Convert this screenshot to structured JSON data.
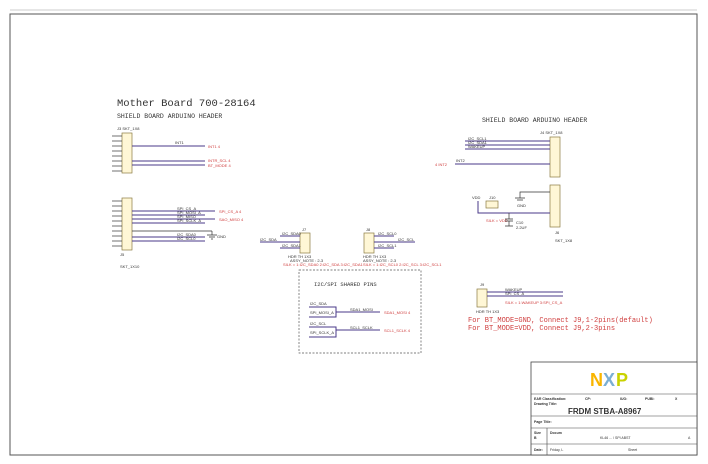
{
  "left": {
    "title": "Mother Board 700-28164",
    "subtitle": "SHIELD BOARD ARDUINO HEADER",
    "j_top": "J3  SKT_1X8",
    "top_nets": [
      "INT1",
      "INT1 4",
      "INTR_SCL 4",
      "BT_MODE 4"
    ],
    "j_bottom": "SKT_1X10",
    "j_bottom_ref": "J5",
    "spi_nets": [
      "SPI_CS_A",
      "SPI_MOSI_A",
      "SPI_MISO",
      "SPI_SCLK_A"
    ],
    "spi_out": [
      "SPI_CS_A 4",
      "SAO_MISO 4"
    ],
    "i2c_nets": [
      "I2C_SDA0",
      "I2C_SCL0"
    ],
    "gnd": "GND"
  },
  "j7": {
    "ref": "J7",
    "nets": [
      "I2C_SDA",
      "I2C_SDA0",
      "I2C_SDA1"
    ],
    "part": "HDR TH 1X3",
    "assy": "ASSY_NOTE : 2-3",
    "silk": "SILK = 1:I2C_SDA0 2:I2C_SDA 3:I2C_SDA1"
  },
  "j8": {
    "ref": "J8",
    "nets": [
      "I2C_SCL0",
      "I2C_SCL",
      "I2C_SCL1"
    ],
    "part": "HDR TH 1X3",
    "assy": "ASSY_NOTE : 2-3",
    "silk": "SILK = 1:I2C_SCL0 2:I2C_SCL 3:I2C_SCL1"
  },
  "shared": {
    "title": "I2C/SPI SHARED PINS",
    "in1": [
      "I2C_SDA",
      "SPI_MOSI_A"
    ],
    "net1": "SDA1_MOSI",
    "out1": "SDA1_MOSI 4",
    "in2": [
      "I2C_SCL",
      "SPI_SCLK_A"
    ],
    "net2": "SCL1_SCLK",
    "out2": "SCL1_SCLK 4"
  },
  "right": {
    "subtitle": "SHIELD BOARD ARDUINO HEADER",
    "j_top": "J4  SKT_1X8",
    "nets": [
      "I2C_SCL1",
      "I2C_SDA1",
      "WAKEUP",
      "INT2"
    ],
    "int_in": "4 INT2",
    "vdd": "VDD",
    "j10": "J10",
    "silk": "SILK = VDD",
    "cap": "C10",
    "cap_val": "2.2UF",
    "gnd": "GND",
    "j_bottom": "J6",
    "j_bottom_part": "SKT_1X8"
  },
  "j9": {
    "ref": "J9",
    "nets": [
      "WAKEUP",
      "SPI_CS_A"
    ],
    "silk": "SILK = 1:WAKEUP 3:SPI_CS_A",
    "part": "HDR TH 1X3"
  },
  "notes": [
    "For BT_MODE=GND, Connect J9,1-2pins(default)",
    "For BT_MODE=VDD, Connect J9,2-3pins"
  ],
  "title_block": {
    "logo": "NXP",
    "logo_colors": [
      "#f9b500",
      "#7bafd4",
      "#c9d200"
    ],
    "ear_label": "EAR Classification:",
    "cp": "CP:",
    "ici": "IUO:",
    "pubi": "PUBI:",
    "pubi_mark": "X",
    "drawing_title_label": "Drawing Title:",
    "drawing_title": "FRDM STBA-A8967",
    "page_title_label": "Page Title:",
    "size_label": "Size",
    "size": "B",
    "doc_label": "Docum",
    "doc_number": "KL46 ... / SPI ABST",
    "rev": "A",
    "date_label": "Date:",
    "date": "Friday, L",
    "sheet_label": "Sheet"
  }
}
